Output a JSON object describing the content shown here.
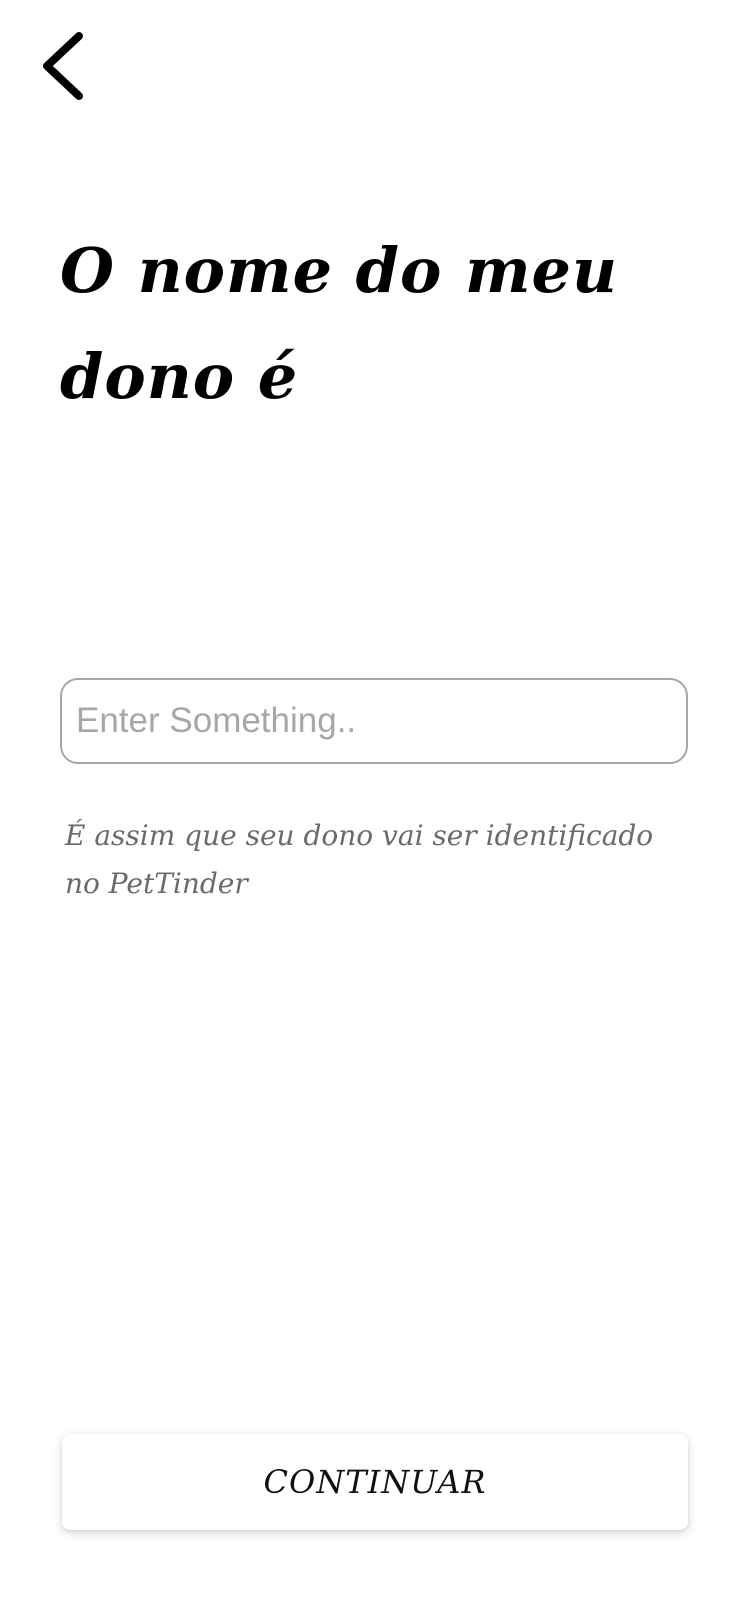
{
  "header": {
    "back_icon": "chevron-left-icon"
  },
  "main": {
    "title": "O nome do meu dono é",
    "input": {
      "value": "",
      "placeholder": "Enter Something.."
    },
    "helper_text": "É assim que seu dono vai ser identificado no PetTinder"
  },
  "footer": {
    "continue_label": "CONTINUAR"
  },
  "colors": {
    "background": "#ffffff",
    "title": "#000000",
    "helper": "#6b6b6b",
    "input_border": "#a6a6a6",
    "placeholder": "#a7a7a7"
  }
}
